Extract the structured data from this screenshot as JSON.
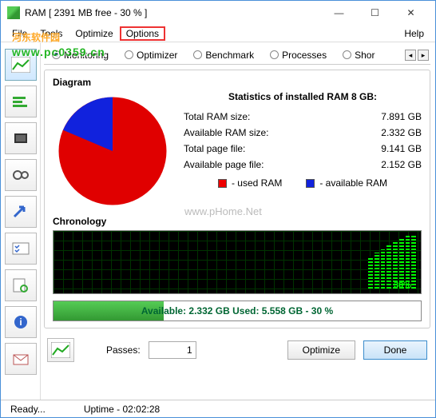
{
  "window": {
    "title": "RAM [ 2391 MB free - 30 % ]"
  },
  "menu": {
    "file": "File",
    "tools": "Tools",
    "optimize": "Optimize",
    "options": "Options",
    "help": "Help"
  },
  "tabs": {
    "monitoring": "Monitoring",
    "optimizer": "Optimizer",
    "benchmark": "Benchmark",
    "processes": "Processes",
    "short": "Shor"
  },
  "diagram": {
    "title": "Diagram",
    "stats_title": "Statistics of installed RAM 8 GB:",
    "rows": [
      {
        "label": "Total RAM size:",
        "value": "7.891 GB"
      },
      {
        "label": "Available RAM size:",
        "value": "2.332 GB"
      },
      {
        "label": "Total page file:",
        "value": "9.141 GB"
      },
      {
        "label": "Available page file:",
        "value": "2.152 GB"
      }
    ],
    "legend_used": "- used RAM",
    "legend_avail": "- available RAM"
  },
  "chronology": {
    "title": "Chronology",
    "pct_badge": "30%"
  },
  "membar": {
    "text": "Available: 2.332 GB   Used: 5.558 GB - 30 %"
  },
  "bottom": {
    "passes_label": "Passes:",
    "passes_value": "1",
    "optimize": "Optimize",
    "done": "Done"
  },
  "status": {
    "ready": "Ready...",
    "uptime": "Uptime - 02:02:28"
  },
  "watermark": {
    "main": "河东软件园",
    "sub": "www.pc0359.cn",
    "mid": "www.pHome.Net"
  },
  "chart_data": {
    "type": "pie",
    "title": "Statistics of installed RAM 8 GB:",
    "series": [
      {
        "name": "used RAM",
        "value": 5.558,
        "color": "#e00000"
      },
      {
        "name": "available RAM",
        "value": 2.332,
        "color": "#1122dd"
      }
    ],
    "unit": "GB"
  }
}
